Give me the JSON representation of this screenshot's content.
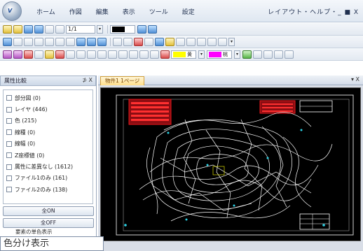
{
  "menubar": {
    "items": [
      "ホーム",
      "作図",
      "編集",
      "表示",
      "ツール",
      "設定"
    ],
    "right_text": "レイアウト・ヘルプ・_ ■ X"
  },
  "toolbar1": {
    "page_value": "1/1"
  },
  "side_panel": {
    "title": "属性比較",
    "controls": "⊅ X",
    "items": [
      "部分図 (0)",
      "レイヤ (446)",
      "色 (215)",
      "線種 (0)",
      "線幅 (0)",
      "Z座標値 (0)",
      "属性に差異なし (1612)",
      "ファイル1のみ (161)",
      "ファイル2のみ (138)"
    ],
    "buttons": {
      "all_on": "全ON",
      "all_off": "全OFF"
    },
    "link": "要素の単色表示"
  },
  "document": {
    "tab_label": "物件1 1ページ",
    "controls": "▾ X"
  },
  "tooltip": {
    "text": "色分け表示"
  },
  "colors": {
    "canvas_bg": "#000000",
    "contour": "#ffffff",
    "title_block": "#e8161b",
    "marker": "#2bd0e3",
    "frame": "#d0d0d0",
    "swatch_yellow": "#ffff00",
    "swatch_magenta": "#ff00ff"
  }
}
